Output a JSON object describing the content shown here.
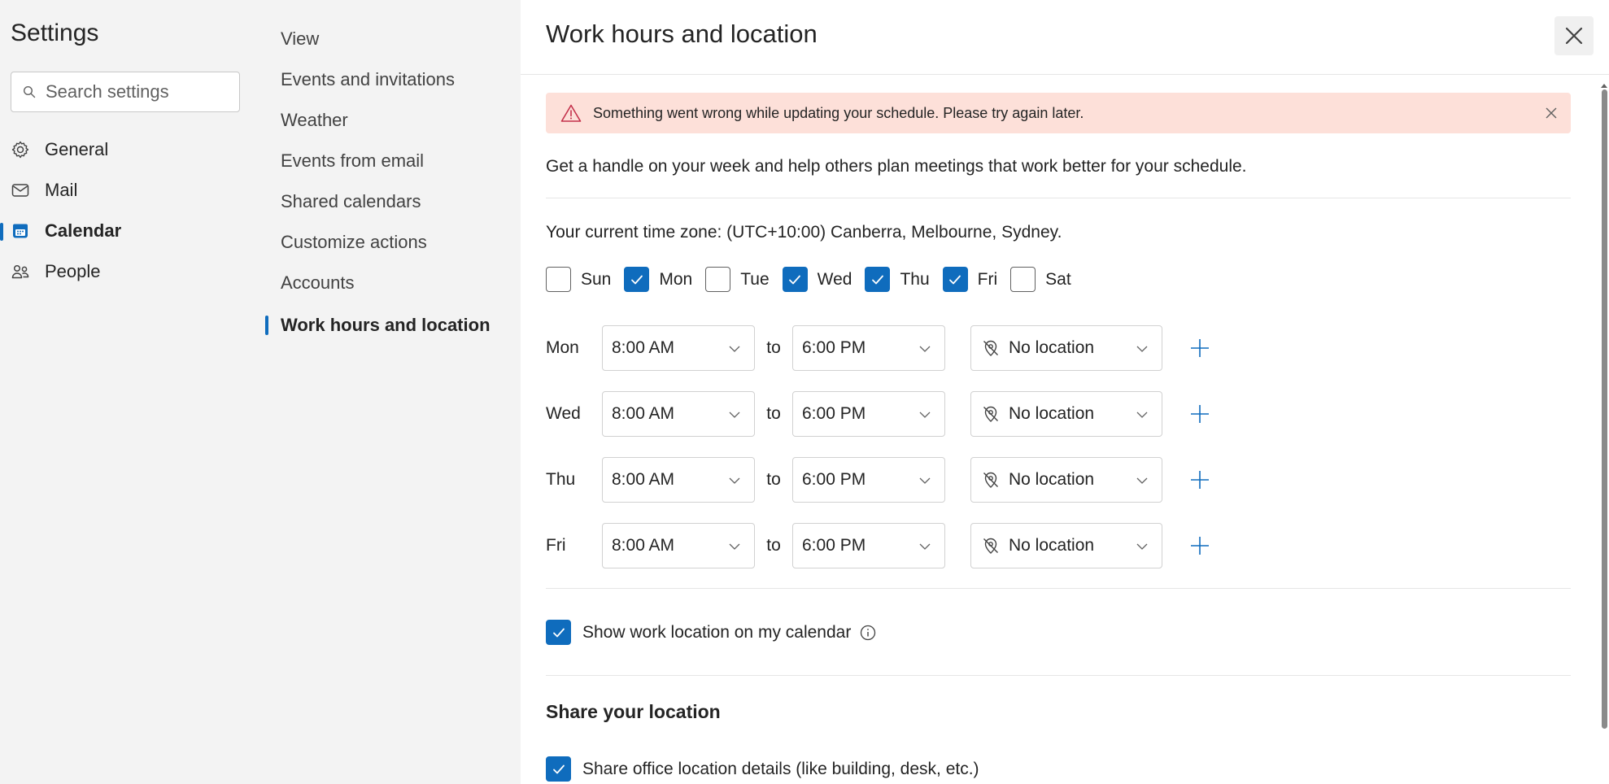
{
  "nav": {
    "title": "Settings",
    "search_placeholder": "Search settings",
    "items": [
      {
        "label": "General",
        "icon": "gear-icon"
      },
      {
        "label": "Mail",
        "icon": "mail-icon"
      },
      {
        "label": "Calendar",
        "icon": "calendar-icon",
        "active": true
      },
      {
        "label": "People",
        "icon": "people-icon"
      }
    ]
  },
  "subnav": {
    "items": [
      {
        "label": "View"
      },
      {
        "label": "Events and invitations"
      },
      {
        "label": "Weather"
      },
      {
        "label": "Events from email"
      },
      {
        "label": "Shared calendars"
      },
      {
        "label": "Customize actions"
      },
      {
        "label": "Accounts"
      },
      {
        "label": "Work hours and location",
        "active": true
      }
    ]
  },
  "main": {
    "title": "Work hours and location",
    "error_message": "Something went wrong while updating your schedule. Please try again later.",
    "intro": "Get a handle on your week and help others plan meetings that work better for your schedule.",
    "timezone": "Your current time zone: (UTC+10:00) Canberra, Melbourne, Sydney.",
    "days": [
      {
        "label": "Sun",
        "checked": false
      },
      {
        "label": "Mon",
        "checked": true
      },
      {
        "label": "Tue",
        "checked": false
      },
      {
        "label": "Wed",
        "checked": true
      },
      {
        "label": "Thu",
        "checked": true
      },
      {
        "label": "Fri",
        "checked": true
      },
      {
        "label": "Sat",
        "checked": false
      }
    ],
    "to_label": "to",
    "schedule": [
      {
        "day": "Mon",
        "start": "8:00 AM",
        "end": "6:00 PM",
        "location": "No location"
      },
      {
        "day": "Wed",
        "start": "8:00 AM",
        "end": "6:00 PM",
        "location": "No location"
      },
      {
        "day": "Thu",
        "start": "8:00 AM",
        "end": "6:00 PM",
        "location": "No location"
      },
      {
        "day": "Fri",
        "start": "8:00 AM",
        "end": "6:00 PM",
        "location": "No location"
      }
    ],
    "show_location_label": "Show work location on my calendar",
    "show_location_checked": true,
    "share_title": "Share your location",
    "share_office_label": "Share office location details (like building, desk, etc.)",
    "share_office_checked": true
  },
  "colors": {
    "accent": "#0f6cbd",
    "error_bg": "#fde0d9",
    "warning_icon": "#c4314b",
    "nav_bg": "#f3f3f3"
  }
}
